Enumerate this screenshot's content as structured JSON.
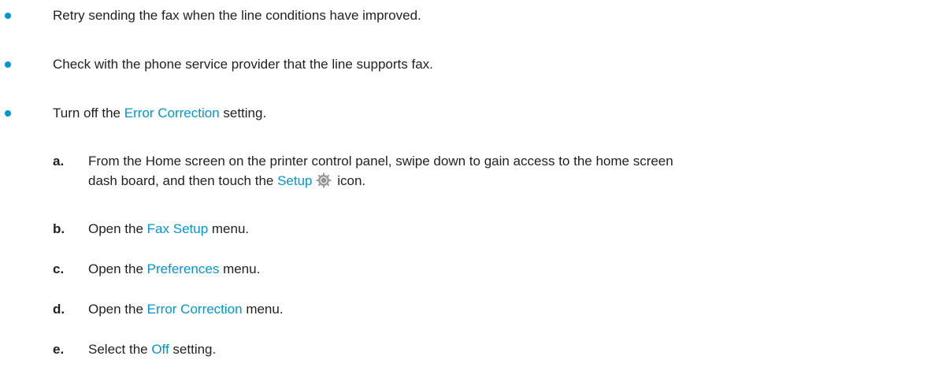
{
  "colors": {
    "accent": "#0096d6",
    "text": "#231f20"
  },
  "bullets": [
    {
      "text": "Retry sending the fax when the line conditions have improved."
    },
    {
      "text": "Check with the phone service provider that the line supports fax."
    },
    {
      "pre": "Turn off the ",
      "link": "Error Correction",
      "post": " setting."
    }
  ],
  "steps": [
    {
      "letter": "a.",
      "line1": "From the Home screen on the printer control panel, swipe down to gain access to the home screen",
      "line2_pre": "dash board, and then touch the ",
      "link": "Setup",
      "icon": "gear-icon",
      "line2_post": " icon."
    },
    {
      "letter": "b.",
      "pre": "Open the ",
      "link": "Fax Setup",
      "post": " menu."
    },
    {
      "letter": "c.",
      "pre": "Open the ",
      "link": "Preferences",
      "post": " menu."
    },
    {
      "letter": "d.",
      "pre": "Open the ",
      "link": "Error Correction",
      "post": " menu."
    },
    {
      "letter": "e.",
      "pre": "Select the ",
      "link": "Off",
      "post": " setting."
    }
  ]
}
